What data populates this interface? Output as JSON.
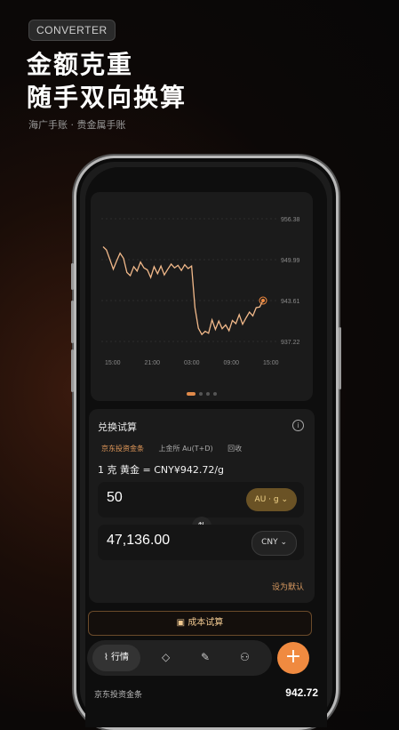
{
  "badge": "CONVERTER",
  "headline": {
    "line1": "金额克重",
    "line2": "随手双向换算"
  },
  "subline": "海广手账 · 贵金属手账",
  "chart_data": {
    "type": "line",
    "x_ticks": [
      "15:00",
      "21:00",
      "03:00",
      "09:00",
      "15:00"
    ],
    "y_ticks": [
      "956.38",
      "949.99",
      "943.61",
      "937.22"
    ],
    "ylim": [
      937.22,
      956.38
    ],
    "series": [
      {
        "values": [
          952.0,
          951.5,
          950.0,
          948.5,
          949.8,
          951.0,
          950.2,
          948.0,
          947.5,
          948.9,
          948.2,
          949.6,
          948.7,
          948.4,
          947.2,
          948.9,
          947.8,
          949.0,
          947.6,
          948.5,
          949.3,
          948.7,
          949.1,
          948.3,
          949.2,
          948.6,
          949.0,
          942.5,
          939.3,
          938.3,
          938.8,
          938.5,
          940.6,
          939.1,
          940.4,
          939.2,
          939.8,
          938.9,
          940.5,
          940.0,
          941.4,
          939.9,
          940.9,
          941.8,
          941.2,
          942.5,
          942.6,
          943.6
        ],
        "last_label": "943.61"
      }
    ]
  },
  "converter": {
    "title": "兑换试算",
    "tabs": [
      "京东投资金条",
      "上金所 Au(T+D)",
      "回收"
    ],
    "rate_text": "1 克 黄金 = CNY¥942.72/g",
    "input_top": "50",
    "unit_top": "AU · g ⌄",
    "input_bottom": "47,136.00",
    "unit_bottom": "CNY ⌄",
    "set_default": "设为默认"
  },
  "cost_button": "成本试算",
  "nav": {
    "active_label": "行情"
  },
  "bottom": {
    "name": "京东投资金条",
    "price": "942.72"
  },
  "colors": {
    "accent": "#f08a40",
    "gold": "#e49a5a",
    "line": "#f2b98a"
  }
}
